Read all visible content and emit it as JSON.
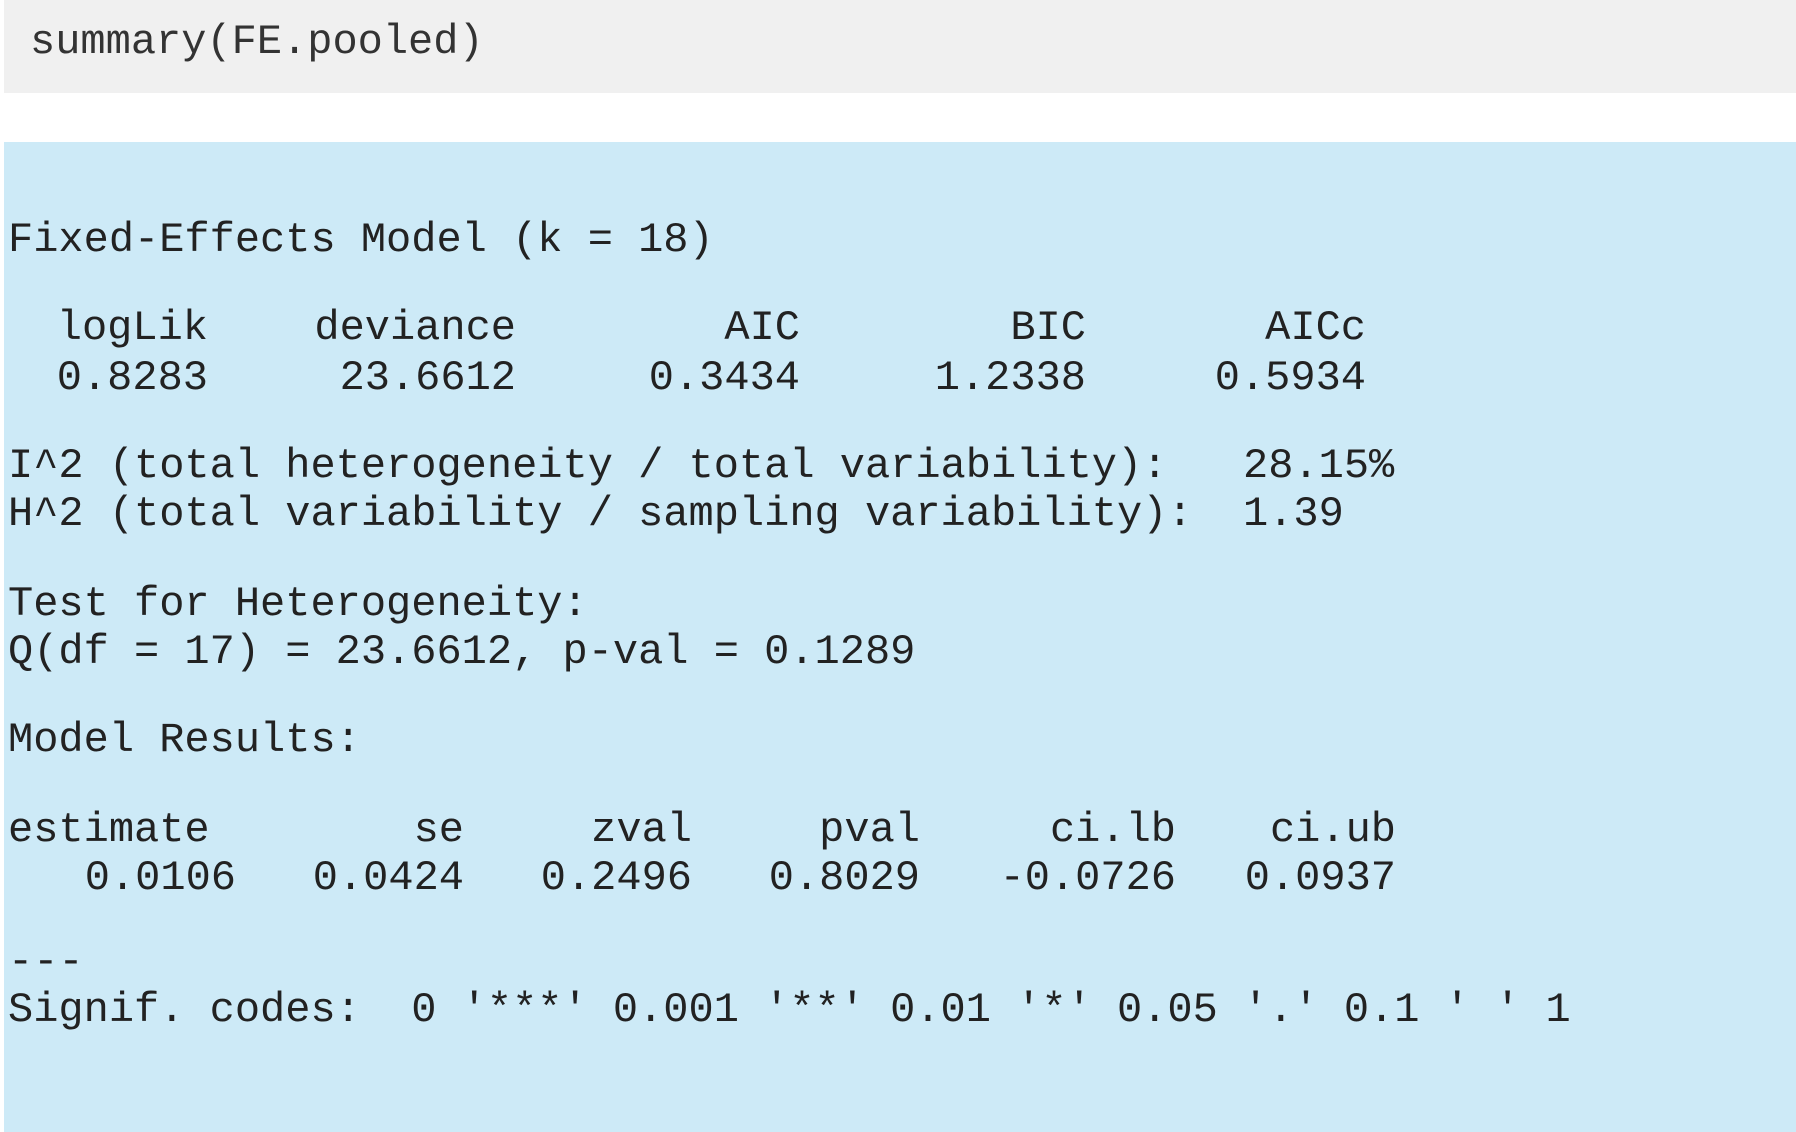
{
  "input": {
    "code": "summary(FE.pooled)"
  },
  "output": {
    "title": "Fixed-Effects Model (k = 18)",
    "fit_stats": {
      "headers": [
        "logLik",
        "deviance",
        "AIC",
        "BIC",
        "AICc"
      ],
      "values": [
        "0.8283",
        "23.6612",
        "0.3434",
        "1.2338",
        "0.5934"
      ]
    },
    "i2_line": "I^2 (total heterogeneity / total variability):   28.15%",
    "h2_line": "H^2 (total variability / sampling variability):  1.39",
    "het_title": "Test for Heterogeneity:",
    "het_result": "Q(df = 17) = 23.6612, p-val = 0.1289",
    "model_title": "Model Results:",
    "model_results": {
      "headers": [
        "estimate",
        "se",
        "zval",
        "pval",
        "ci.lb",
        "ci.ub"
      ],
      "values": [
        "0.0106",
        "0.0424",
        "0.2496",
        "0.8029",
        "-0.0726",
        "0.0937"
      ]
    },
    "separator": "---",
    "signif_codes": "Signif. codes:  0 '***' 0.001 '**' 0.01 '*' 0.05 '.' 0.1 ' ' 1"
  }
}
